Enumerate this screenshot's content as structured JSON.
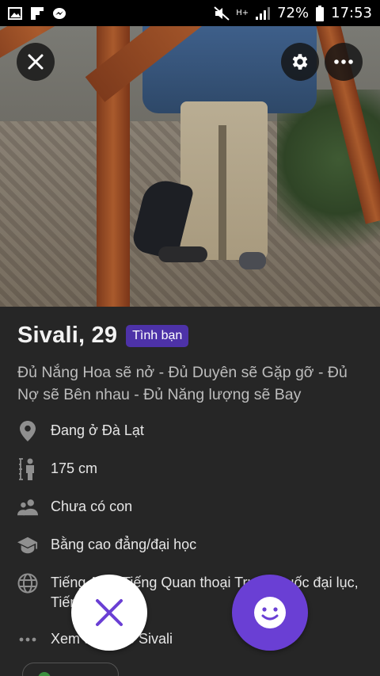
{
  "status_bar": {
    "battery": "72%",
    "time": "17:53",
    "network": "H+"
  },
  "profile": {
    "name_age": "Sivali, 29",
    "badge": "Tình bạn",
    "bio": "Đủ Nắng Hoa sẽ nở - Đủ Duyên sẽ Gặp gỡ - Đủ Nợ sẽ Bên nhau - Đủ Năng lượng sẽ Bay",
    "details": [
      {
        "icon": "location-pin-icon",
        "text": "Đang ở Đà Lạt"
      },
      {
        "icon": "height-icon",
        "text": "175 cm"
      },
      {
        "icon": "children-icon",
        "text": "Chưa có con"
      },
      {
        "icon": "graduation-cap-icon",
        "text": "Bằng cao đẳng/đại học"
      },
      {
        "icon": "globe-icon",
        "text": "Tiếng Anh, Tiếng Quan thoại Trung Quốc đại lục, Tiếng Việt"
      },
      {
        "icon": "more-horizontal-icon",
        "text": "Xem thêm về Sivali"
      }
    ]
  },
  "actions": {
    "pass_color": "#6a3fd4",
    "like_color": "#6a3fd4"
  }
}
